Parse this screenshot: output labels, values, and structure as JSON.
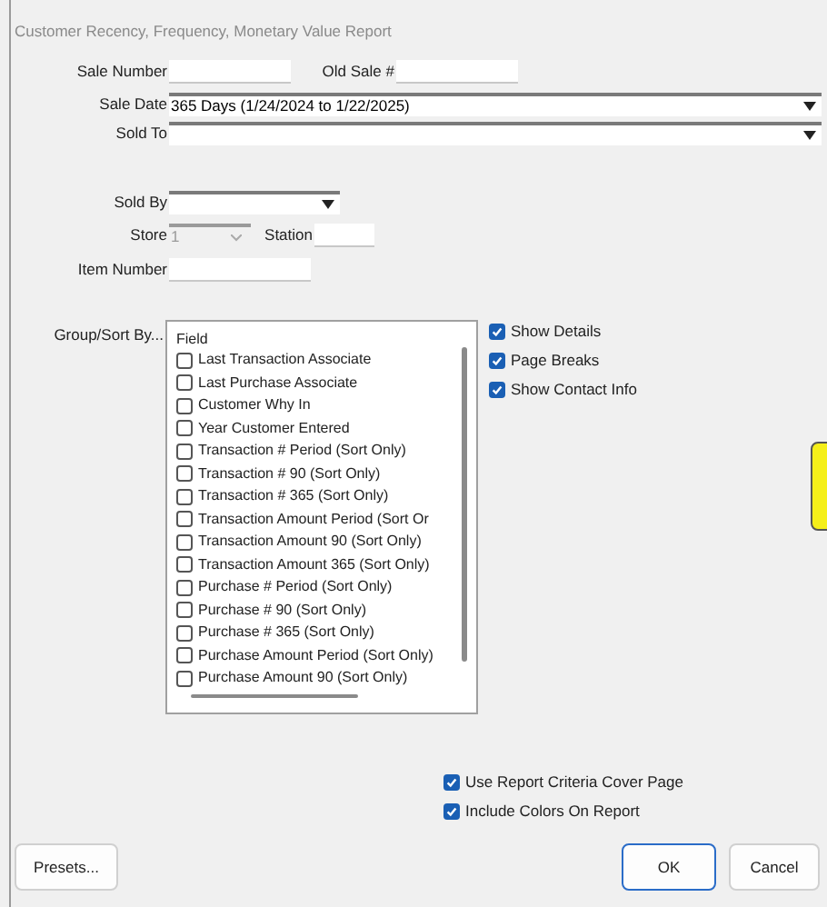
{
  "window": {
    "title": "Customer Recency, Frequency, Monetary Value Report"
  },
  "sale_number": {
    "label": "Sale Number"
  },
  "old_sale": {
    "label": "Old Sale #"
  },
  "sale_date": {
    "label": "Sale Date",
    "value": "365 Days (1/24/2024 to 1/22/2025)"
  },
  "sold_to": {
    "label": "Sold To"
  },
  "sold_by": {
    "label": "Sold By"
  },
  "store": {
    "label": "Store",
    "value": "1",
    "disabled": true
  },
  "station": {
    "label": "Station"
  },
  "item_number": {
    "label": "Item Number"
  },
  "group_sort": {
    "label": "Group/Sort By...",
    "header": "Field",
    "items": [
      {
        "label": "Last Transaction Associate",
        "checked": false
      },
      {
        "label": "Last Purchase Associate",
        "checked": false
      },
      {
        "label": "Customer Why In",
        "checked": false
      },
      {
        "label": "Year Customer Entered",
        "checked": false
      },
      {
        "label": "Transaction # Period (Sort Only)",
        "checked": false
      },
      {
        "label": "Transaction # 90 (Sort Only)",
        "checked": false
      },
      {
        "label": "Transaction # 365 (Sort Only)",
        "checked": false
      },
      {
        "label": "Transaction Amount Period (Sort Or",
        "checked": false
      },
      {
        "label": "Transaction Amount 90 (Sort Only)",
        "checked": false
      },
      {
        "label": "Transaction Amount 365 (Sort Only)",
        "checked": false
      },
      {
        "label": "Purchase # Period (Sort Only)",
        "checked": false
      },
      {
        "label": "Purchase # 90 (Sort Only)",
        "checked": false
      },
      {
        "label": "Purchase # 365 (Sort Only)",
        "checked": false
      },
      {
        "label": "Purchase Amount Period (Sort Only)",
        "checked": false
      },
      {
        "label": "Purchase Amount 90 (Sort Only)",
        "checked": false
      }
    ]
  },
  "options": [
    {
      "label": "Show Details",
      "checked": true
    },
    {
      "label": "Page Breaks",
      "checked": true
    },
    {
      "label": "Show Contact Info",
      "checked": true
    }
  ],
  "report_options": [
    {
      "label": "Use Report Criteria Cover Page",
      "checked": true
    },
    {
      "label": "Include Colors On Report",
      "checked": true
    }
  ],
  "buttons": [
    {
      "label": "Presets...",
      "default": false
    },
    {
      "label": "OK",
      "default": true
    },
    {
      "label": "Cancel",
      "default": false
    }
  ]
}
